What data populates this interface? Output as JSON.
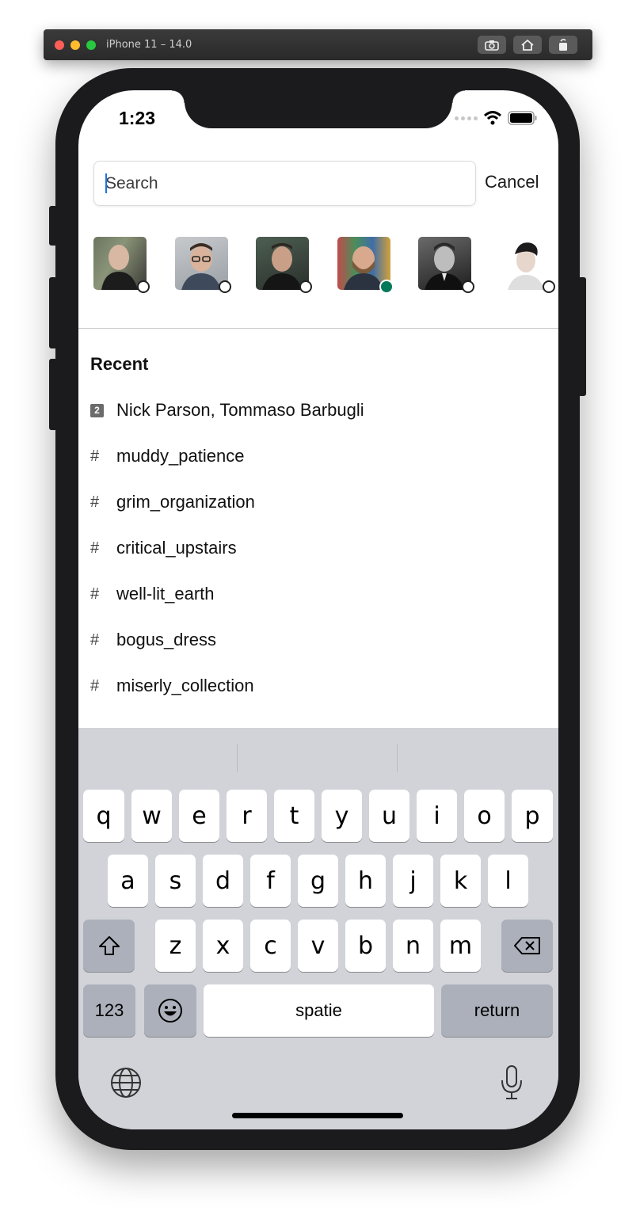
{
  "simulator": {
    "title": "iPhone 11 – 14.0"
  },
  "status_bar": {
    "time": "1:23"
  },
  "search": {
    "placeholder": "Search",
    "cancel_label": "Cancel"
  },
  "avatars": [
    {
      "name": "user-1",
      "status": "away"
    },
    {
      "name": "user-2",
      "status": "away"
    },
    {
      "name": "user-3",
      "status": "away"
    },
    {
      "name": "user-4",
      "status": "online"
    },
    {
      "name": "user-5",
      "status": "away"
    },
    {
      "name": "user-6",
      "status": "away"
    }
  ],
  "recent": {
    "title": "Recent",
    "items": [
      {
        "type": "dm",
        "badge": "2",
        "label": "Nick Parson, Tommaso Barbugli"
      },
      {
        "type": "channel",
        "glyph": "#",
        "label": "muddy_patience"
      },
      {
        "type": "channel",
        "glyph": "#",
        "label": "grim_organization"
      },
      {
        "type": "channel",
        "glyph": "#",
        "label": "critical_upstairs"
      },
      {
        "type": "channel",
        "glyph": "#",
        "label": "well-lit_earth"
      },
      {
        "type": "channel",
        "glyph": "#",
        "label": "bogus_dress"
      },
      {
        "type": "channel",
        "glyph": "#",
        "label": "miserly_collection"
      }
    ]
  },
  "keyboard": {
    "row1": [
      "q",
      "w",
      "e",
      "r",
      "t",
      "y",
      "u",
      "i",
      "o",
      "p"
    ],
    "row2": [
      "a",
      "s",
      "d",
      "f",
      "g",
      "h",
      "j",
      "k",
      "l"
    ],
    "row3": [
      "z",
      "x",
      "c",
      "v",
      "b",
      "n",
      "m"
    ],
    "numbers_label": "123",
    "space_label": "spatie",
    "return_label": "return"
  },
  "colors": {
    "online": "#007a5a",
    "caret": "#1a73e8",
    "keyboard_bg": "#d1d3d9"
  }
}
